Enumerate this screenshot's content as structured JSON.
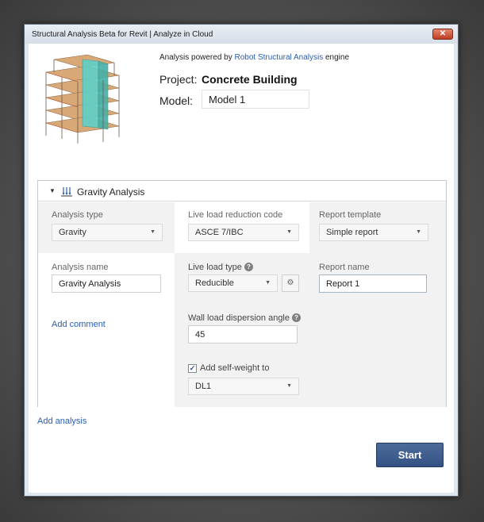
{
  "window": {
    "title": "Structural Analysis Beta for Revit | Analyze in Cloud",
    "close_icon": "close-x-icon"
  },
  "header": {
    "powered_prefix": "Analysis powered by ",
    "powered_link": "Robot Structural Analysis",
    "powered_suffix": " engine",
    "project_label": "Project:",
    "project_name": "Concrete Building",
    "model_label": "Model:",
    "model_value": "Model 1"
  },
  "analysis": {
    "title": "Gravity Analysis",
    "caret": "▼",
    "analysis_type_label": "Analysis type",
    "analysis_type_value": "Gravity",
    "live_load_code_label": "Live load reduction code",
    "live_load_code_value": "ASCE 7/IBC",
    "report_template_label": "Report template",
    "report_template_value": "Simple report",
    "analysis_name_label": "Analysis name",
    "analysis_name_value": "Gravity Analysis",
    "live_load_type_label": "Live load type",
    "live_load_type_value": "Reducible",
    "report_name_label": "Report name",
    "report_name_value": "Report 1",
    "add_comment": "Add comment",
    "wall_angle_label": "Wall load dispersion angle",
    "wall_angle_value": "45",
    "self_weight_label": "Add self-weight to",
    "self_weight_checked": true,
    "self_weight_value": "DL1"
  },
  "footer": {
    "add_analysis": "Add analysis",
    "start_label": "Start"
  },
  "colors": {
    "accent": "#2a5db0",
    "start_button": "#3f5d8f",
    "column_bg": "#f2f2f2"
  }
}
